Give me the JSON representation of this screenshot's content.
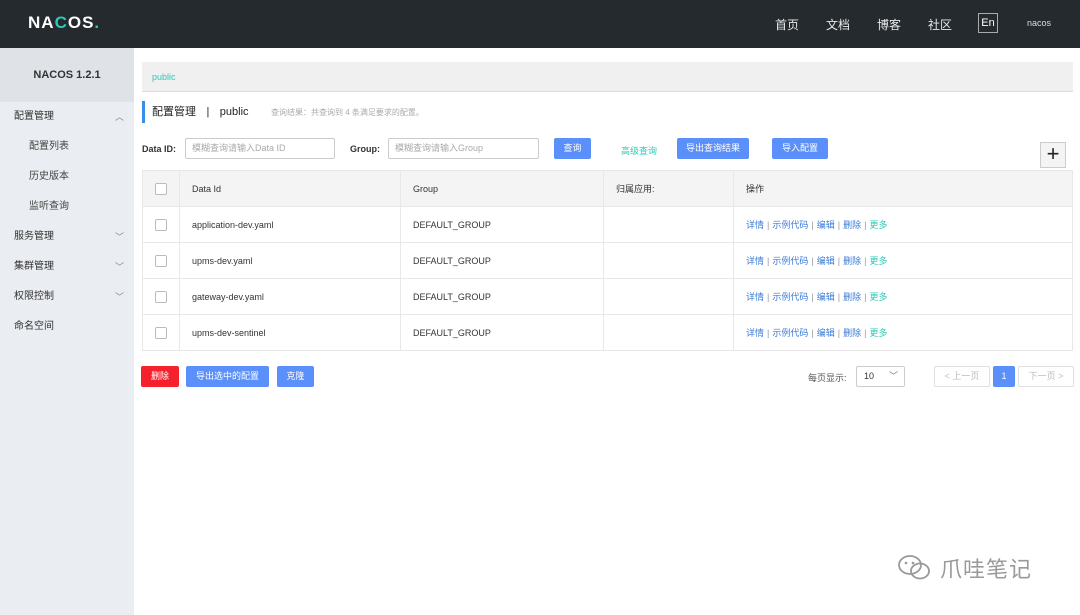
{
  "header": {
    "logo": "NACOS.",
    "nav": [
      "首页",
      "文档",
      "博客",
      "社区"
    ],
    "lang": "En",
    "user": "nacos"
  },
  "sidebar": {
    "version": "NACOS 1.2.1",
    "items": [
      {
        "label": "配置管理",
        "arrow": "^"
      },
      {
        "label": "配置列表"
      },
      {
        "label": "历史版本"
      },
      {
        "label": "监听查询"
      },
      {
        "label": "服务管理",
        "arrow": "v"
      },
      {
        "label": "集群管理",
        "arrow": "v"
      },
      {
        "label": "权限控制",
        "arrow": "v"
      },
      {
        "label": "命名空间"
      }
    ]
  },
  "breadcrumb": "public",
  "page": {
    "title": "配置管理",
    "sep": "|",
    "namespace": "public",
    "result": "查询结果：共查询到 4 条满足要求的配置。"
  },
  "search": {
    "dataid_label": "Data ID:",
    "dataid_placeholder": "模糊查询请输入Data ID",
    "group_label": "Group:",
    "group_placeholder": "模糊查询请输入Group",
    "query_button": "查询",
    "advanced": "高级查询",
    "export_button": "导出查询结果",
    "import_button": "导入配置",
    "add_button": "+"
  },
  "table": {
    "headers": [
      "Data Id",
      "Group",
      "归属应用:",
      "操作"
    ],
    "rows": [
      {
        "dataid": "application-dev.yaml",
        "group": "DEFAULT_GROUP",
        "app": ""
      },
      {
        "dataid": "upms-dev.yaml",
        "group": "DEFAULT_GROUP",
        "app": ""
      },
      {
        "dataid": "gateway-dev.yaml",
        "group": "DEFAULT_GROUP",
        "app": ""
      },
      {
        "dataid": "upms-dev-sentinel",
        "group": "DEFAULT_GROUP",
        "app": ""
      }
    ],
    "ops": {
      "detail": "详情",
      "sample": "示例代码",
      "edit": "编辑",
      "delete": "删除",
      "more": "更多",
      "sep": "|"
    }
  },
  "actions": {
    "delete": "删除",
    "export_selected": "导出选中的配置",
    "clone": "克隆"
  },
  "pagination": {
    "size_label": "每页显示:",
    "size_value": "10",
    "prev": "< 上一页",
    "current": "1",
    "next": "下一页 >"
  },
  "watermark": "爪哇笔记"
}
